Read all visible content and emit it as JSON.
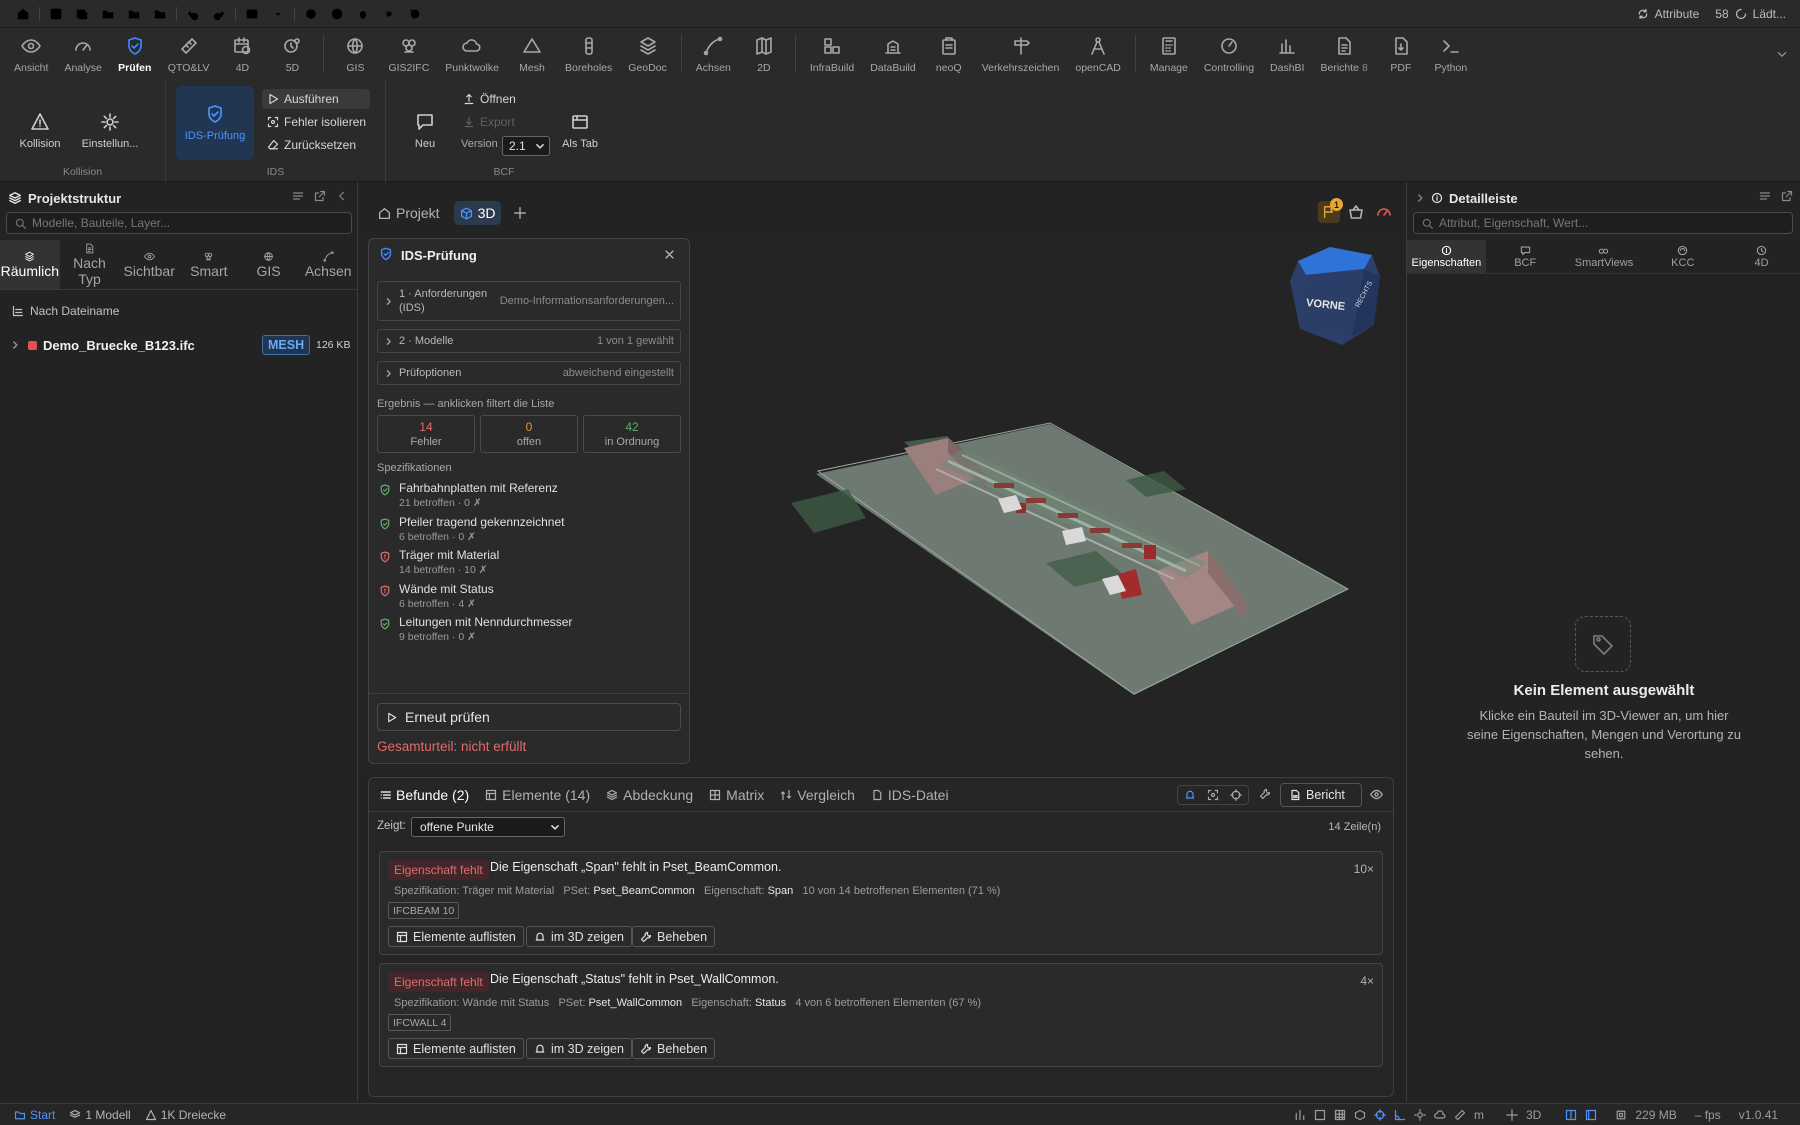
{
  "quickbar": {
    "right_label": "Attribute",
    "right_count": "58",
    "loading": "Lädt..."
  },
  "ribbon": {
    "tabs": [
      {
        "label": "Ansicht",
        "icon": "eye-icon"
      },
      {
        "label": "Analyse",
        "icon": "gauge-icon"
      },
      {
        "label": "Prüfen",
        "icon": "shield-check-icon",
        "active": true
      },
      {
        "label": "QTO&LV",
        "icon": "ruler-icon"
      },
      {
        "label": "4D",
        "icon": "calendar-clock-icon"
      },
      {
        "label": "5D",
        "icon": "coin-clock-icon"
      },
      {
        "label": "GIS",
        "icon": "globe-icon"
      },
      {
        "label": "GIS2IFC",
        "icon": "layers-icon"
      },
      {
        "label": "Punktwolke",
        "icon": "cloud-icon"
      },
      {
        "label": "Mesh",
        "icon": "triangle-icon"
      },
      {
        "label": "Boreholes",
        "icon": "borehole-icon"
      },
      {
        "label": "GeoDoc",
        "icon": "stack-icon"
      },
      {
        "label": "Achsen",
        "icon": "curve-icon"
      },
      {
        "label": "2D",
        "icon": "map-icon"
      },
      {
        "label": "InfraBuild",
        "icon": "blocks-icon"
      },
      {
        "label": "DataBuild",
        "icon": "building-icon"
      },
      {
        "label": "neoQ",
        "icon": "clipboard-icon"
      },
      {
        "label": "Verkehrszeichen",
        "icon": "signpost-icon"
      },
      {
        "label": "openCAD",
        "icon": "compass-icon"
      },
      {
        "label": "Manage",
        "icon": "calculator-icon"
      },
      {
        "label": "Controlling",
        "icon": "dial-icon"
      },
      {
        "label": "DashBI",
        "icon": "bar-chart-icon"
      },
      {
        "label": "Berichte",
        "badge": "8",
        "icon": "report-icon"
      },
      {
        "label": "PDF",
        "icon": "pdf-icon"
      },
      {
        "label": "Python",
        "icon": "terminal-icon"
      }
    ]
  },
  "tools": {
    "kollision": {
      "group": "Kollision",
      "btn1": "Kollision",
      "btn2": "Einstellun..."
    },
    "ids": {
      "group": "IDS",
      "main": "IDS-Prüfung",
      "run": "Ausführen",
      "isolate": "Fehler isolieren",
      "reset": "Zurücksetzen"
    },
    "bcf": {
      "group": "BCF",
      "new": "Neu",
      "open": "Öffnen",
      "export": "Export",
      "version_label": "Version",
      "version": "2.1",
      "as_tab": "Als Tab"
    }
  },
  "left": {
    "title": "Projektstruktur",
    "search_placeholder": "Modelle, Bauteile, Layer...",
    "tabs": [
      {
        "label": "Räumlich",
        "active": true
      },
      {
        "label": "Nach Typ"
      },
      {
        "label": "Sichtbar"
      },
      {
        "label": "Smart"
      },
      {
        "label": "GIS"
      },
      {
        "label": "Achsen"
      }
    ],
    "group_by": "Nach Dateiname",
    "file": {
      "name": "Demo_Bruecke_B123.ifc",
      "tag": "MESH",
      "size": "126 KB"
    }
  },
  "center": {
    "tab_project": "Projekt",
    "tab_3d": "3D",
    "notify_count": "1",
    "cube_label": "VORNE",
    "cube_side": "RECHTS"
  },
  "ids_panel": {
    "title": "IDS-Prüfung",
    "rows": [
      {
        "label": "1 · Anforderungen (IDS)",
        "value": "Demo-Informationsanforderungen..."
      },
      {
        "label": "2 · Modelle",
        "value": "1 von 1 gewählt"
      },
      {
        "label": "Prüfoptionen",
        "value": "abweichend eingestellt"
      }
    ],
    "result_label": "Ergebnis — anklicken filtert die Liste",
    "stats": [
      {
        "value": "14",
        "label": "Fehler",
        "color": "#e06c6c"
      },
      {
        "value": "0",
        "label": "offen",
        "color": "#d99a3a"
      },
      {
        "value": "42",
        "label": "in Ordnung",
        "color": "#5fae6a"
      }
    ],
    "spec_label": "Spezifikationen",
    "specs": [
      {
        "name": "Fahrbahnplatten mit Referenz",
        "detail": "21 betroffen · 0 ✗",
        "ok": true
      },
      {
        "name": "Pfeiler tragend gekennzeichnet",
        "detail": "6 betroffen · 0 ✗",
        "ok": true
      },
      {
        "name": "Träger mit Material",
        "detail": "14 betroffen · 10 ✗",
        "ok": false
      },
      {
        "name": "Wände mit Status",
        "detail": "6 betroffen · 4 ✗",
        "ok": false
      },
      {
        "name": "Leitungen mit Nenndurchmesser",
        "detail": "9 betroffen · 0 ✗",
        "ok": true
      }
    ],
    "recheck": "Erneut prüfen",
    "verdict": "Gesamturteil: nicht erfüllt"
  },
  "findings": {
    "tabs": [
      {
        "label": "Befunde (2)",
        "active": true
      },
      {
        "label": "Elemente (14)"
      },
      {
        "label": "Abdeckung"
      },
      {
        "label": "Matrix"
      },
      {
        "label": "Vergleich"
      },
      {
        "label": "IDS-Datei"
      }
    ],
    "report": "Bericht",
    "show_label": "Zeigt:",
    "show_value": "offene Punkte",
    "rowcount": "14 Zeile(n)",
    "items": [
      {
        "tag": "Eigenschaft fehlt",
        "title": "Die Eigenschaft „Span\" fehlt in Pset_BeamCommon.",
        "count": "10×",
        "spec_label": "Spezifikation: Träger mit Material",
        "pset_label": "PSet:",
        "pset": "Pset_BeamCommon",
        "prop_label": "Eigenschaft:",
        "prop": "Span",
        "share": "10 von 14 betroffenen Elementen (71 %)",
        "entity": "IFCBEAM 10"
      },
      {
        "tag": "Eigenschaft fehlt",
        "title": "Die Eigenschaft „Status\" fehlt in Pset_WallCommon.",
        "count": "4×",
        "spec_label": "Spezifikation: Wände mit Status",
        "pset_label": "PSet:",
        "pset": "Pset_WallCommon",
        "prop_label": "Eigenschaft:",
        "prop": "Status",
        "share": "4 von 6 betroffenen Elementen (67 %)",
        "entity": "IFCWALL 4"
      }
    ],
    "btn_list": "Elemente auflisten",
    "btn_3d": "im 3D zeigen",
    "btn_fix": "Beheben"
  },
  "right": {
    "title": "Detailleiste",
    "search_placeholder": "Attribut, Eigenschaft, Wert...",
    "tabs": [
      {
        "label": "Eigenschaften",
        "active": true
      },
      {
        "label": "BCF"
      },
      {
        "label": "SmartViews"
      },
      {
        "label": "KCC"
      },
      {
        "label": "4D"
      }
    ],
    "empty_title": "Kein Element ausgewählt",
    "empty_text": "Klicke ein Bauteil im 3D-Viewer an, um hier seine Eigenschaften, Mengen und Verortung zu sehen."
  },
  "status": {
    "start": "Start",
    "models": "1 Modell",
    "triangles": "1K Dreiecke",
    "unit": "m",
    "mode": "3D",
    "memory": "229 MB",
    "fps": "– fps",
    "version": "v1.0.41"
  },
  "colors": {
    "accent": "#3d8bff",
    "error": "#e06c6c",
    "warning": "#d99a3a",
    "ok": "#5fae6a"
  }
}
